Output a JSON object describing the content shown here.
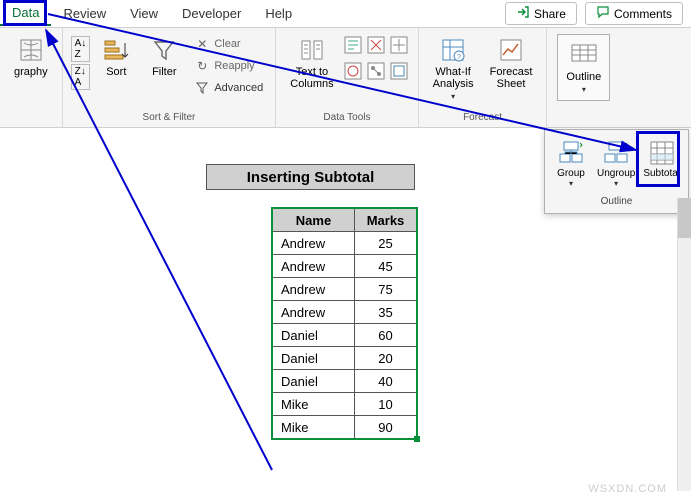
{
  "tabs": {
    "active": "Data",
    "items": [
      "Data",
      "Review",
      "View",
      "Developer",
      "Help"
    ]
  },
  "actions": {
    "share": "Share",
    "comments": "Comments"
  },
  "ribbon": {
    "geography": "graphy",
    "sort": "Sort",
    "filter": "Filter",
    "clear": "Clear",
    "reapply": "Reapply",
    "advanced": "Advanced",
    "sort_filter_group": "Sort & Filter",
    "text_to_columns": "Text to\nColumns",
    "data_tools_group": "Data Tools",
    "whatif": "What-If\nAnalysis",
    "forecast_sheet": "Forecast\nSheet",
    "forecast_group": "Forecast",
    "outline": "Outline",
    "outline_group": ""
  },
  "dropdown": {
    "group": "Group",
    "ungroup": "Ungroup",
    "subtotal": "Subtotal",
    "label": "Outline"
  },
  "sheet": {
    "title": "Inserting Subtotal",
    "headers": {
      "name": "Name",
      "marks": "Marks"
    },
    "rows": [
      {
        "name": "Andrew",
        "marks": "25"
      },
      {
        "name": "Andrew",
        "marks": "45"
      },
      {
        "name": "Andrew",
        "marks": "75"
      },
      {
        "name": "Andrew",
        "marks": "35"
      },
      {
        "name": "Daniel",
        "marks": "60"
      },
      {
        "name": "Daniel",
        "marks": "20"
      },
      {
        "name": "Daniel",
        "marks": "40"
      },
      {
        "name": "Mike",
        "marks": "10"
      },
      {
        "name": "Mike",
        "marks": "90"
      }
    ]
  },
  "watermark": "WSXDN.COM"
}
